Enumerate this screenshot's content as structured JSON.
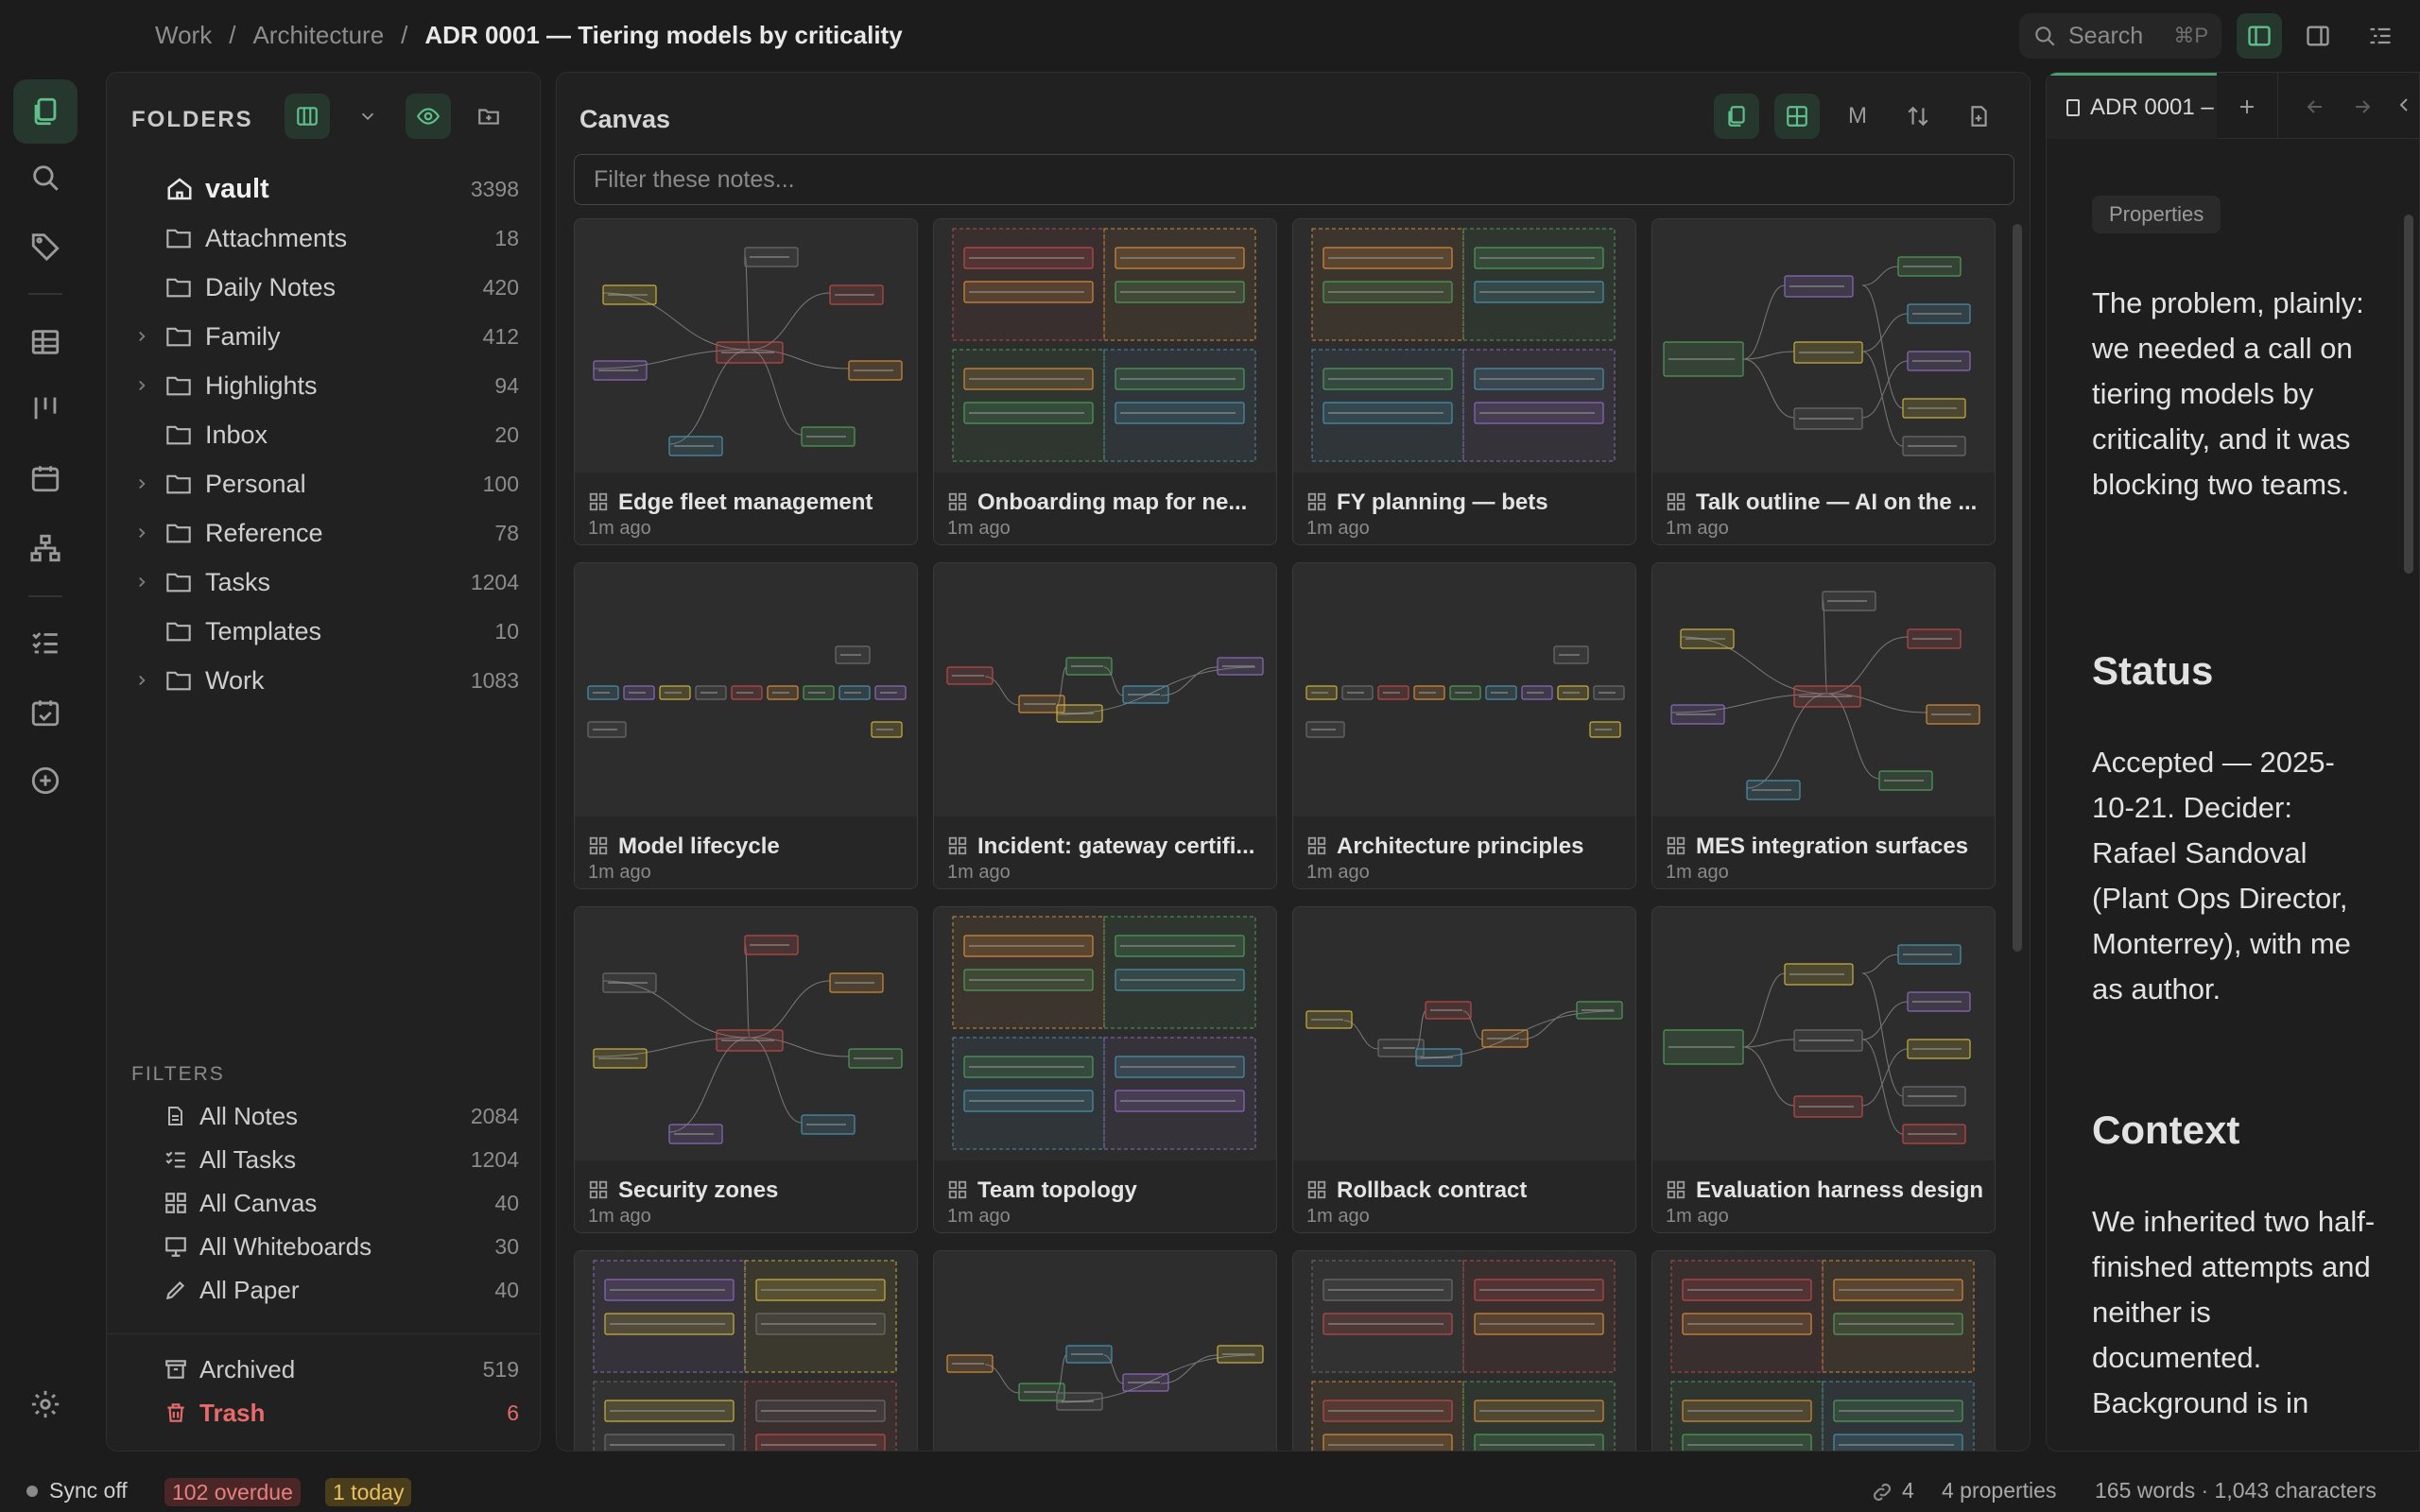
{
  "breadcrumb": {
    "items": [
      "Work",
      "Architecture"
    ],
    "current": "ADR 0001 — Tiering models by criticality",
    "separator": "/"
  },
  "search": {
    "label": "Search",
    "shortcut": "⌘P"
  },
  "folders": {
    "title": "FOLDERS",
    "tree": [
      {
        "label": "vault",
        "count": "3398",
        "expandable": false,
        "root": true
      },
      {
        "label": "Attachments",
        "count": "18",
        "expandable": false
      },
      {
        "label": "Daily Notes",
        "count": "420",
        "expandable": false
      },
      {
        "label": "Family",
        "count": "412",
        "expandable": true
      },
      {
        "label": "Highlights",
        "count": "94",
        "expandable": true
      },
      {
        "label": "Inbox",
        "count": "20",
        "expandable": false
      },
      {
        "label": "Personal",
        "count": "100",
        "expandable": true
      },
      {
        "label": "Reference",
        "count": "78",
        "expandable": true
      },
      {
        "label": "Tasks",
        "count": "1204",
        "expandable": true
      },
      {
        "label": "Templates",
        "count": "10",
        "expandable": false
      },
      {
        "label": "Work",
        "count": "1083",
        "expandable": true
      }
    ]
  },
  "filters": {
    "title": "FILTERS",
    "items": [
      {
        "label": "All Notes",
        "count": "2084",
        "icon": "note-icon"
      },
      {
        "label": "All Tasks",
        "count": "1204",
        "icon": "tasks-icon"
      },
      {
        "label": "All Canvas",
        "count": "40",
        "icon": "canvas-icon"
      },
      {
        "label": "All Whiteboards",
        "count": "30",
        "icon": "whiteboard-icon"
      },
      {
        "label": "All Paper",
        "count": "40",
        "icon": "pen-icon"
      }
    ],
    "archived": {
      "label": "Archived",
      "count": "519"
    },
    "trash": {
      "label": "Trash",
      "count": "6"
    }
  },
  "canvas": {
    "title": "Canvas",
    "filter_placeholder": "Filter these notes...",
    "view_mode_letter": "M",
    "cards": [
      {
        "title": "Edge fleet management",
        "time": "1m ago",
        "kind": "mind"
      },
      {
        "title": "Onboarding map for ne...",
        "time": "1m ago",
        "kind": "kanban"
      },
      {
        "title": "FY planning — bets",
        "time": "1m ago",
        "kind": "kanban"
      },
      {
        "title": "Talk outline — AI on the ...",
        "time": "1m ago",
        "kind": "tree"
      },
      {
        "title": "Model lifecycle",
        "time": "1m ago",
        "kind": "line"
      },
      {
        "title": "Incident: gateway certifi...",
        "time": "1m ago",
        "kind": "flow"
      },
      {
        "title": "Architecture principles",
        "time": "1m ago",
        "kind": "line"
      },
      {
        "title": "MES integration surfaces",
        "time": "1m ago",
        "kind": "mind"
      },
      {
        "title": "Security zones",
        "time": "1m ago",
        "kind": "mind"
      },
      {
        "title": "Team topology",
        "time": "1m ago",
        "kind": "kanban"
      },
      {
        "title": "Rollback contract",
        "time": "1m ago",
        "kind": "flow"
      },
      {
        "title": "Evaluation harness design",
        "time": "1m ago",
        "kind": "tree"
      },
      {
        "title": "",
        "time": "",
        "kind": "kanban"
      },
      {
        "title": "",
        "time": "",
        "kind": "flow"
      },
      {
        "title": "",
        "time": "",
        "kind": "kanban"
      },
      {
        "title": "",
        "time": "",
        "kind": "kanban"
      }
    ]
  },
  "note": {
    "tab_title": "ADR 0001 –",
    "properties_label": "Properties",
    "intro": "The problem, plainly: we needed a call on tiering models by criticality, and it was blocking two teams.",
    "h_status": "Status",
    "status_text": "Accepted — 2025-10-21. Decider: Rafael Sandoval (Plant Ops Director, Monterrey), with me as author.",
    "h_context": "Context",
    "context_text": "We inherited two half-finished attempts and neither is documented. Background is in"
  },
  "status": {
    "sync": "Sync off",
    "overdue": "102 overdue",
    "today": "1 today",
    "links": "4",
    "properties": "4 properties",
    "words": "165 words · 1,043 characters"
  },
  "colors": {
    "accent": "#4a9e74",
    "overdue": "#e06a6a",
    "today": "#e0b84a",
    "trash": "#e86a6a"
  }
}
